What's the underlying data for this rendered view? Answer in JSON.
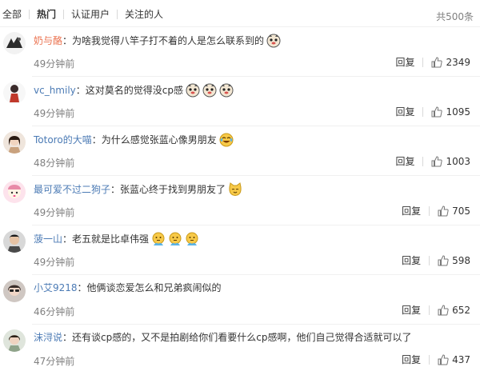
{
  "filters": {
    "tabs": [
      "全部",
      "热门",
      "认证用户",
      "关注的人"
    ],
    "active": "热门",
    "total": "共500条"
  },
  "colors": {
    "name_orange": "#eb7350",
    "name_blue": "#4c7bb5",
    "muted": "#808080"
  },
  "comments": [
    {
      "user": "奶与酪",
      "text": "：为啥我觉得八竿子打不着的人是怎么联系到的",
      "emojis": [
        "doge-icon"
      ],
      "time": "49分钟前",
      "reply": "回复",
      "likes": "2349",
      "avatar": "avatar-1"
    },
    {
      "user": "vc_hmily",
      "text": "：这对莫名的觉得没cp感",
      "emojis": [
        "doge-icon",
        "doge-icon",
        "doge-icon"
      ],
      "time": "49分钟前",
      "reply": "回复",
      "likes": "1095",
      "avatar": "avatar-2"
    },
    {
      "user": "Totoro的大喵",
      "text": "：为什么感觉张蓝心像男朋友",
      "emojis": [
        "laugh-cry-icon"
      ],
      "time": "48分钟前",
      "reply": "回复",
      "likes": "1003",
      "avatar": "avatar-3"
    },
    {
      "user": "最可爱不过二狗子",
      "text": "：张蓝心终于找到男朋友了",
      "emojis": [
        "cat-icon"
      ],
      "time": "49分钟前",
      "reply": "回复",
      "likes": "705",
      "avatar": "avatar-4"
    },
    {
      "user": "菠一山",
      "text": "：老五就是比卓伟强",
      "emojis": [
        "thinking-icon",
        "thinking-icon",
        "thinking-icon"
      ],
      "time": "49分钟前",
      "reply": "回复",
      "likes": "598",
      "avatar": "avatar-5"
    },
    {
      "user": "小艾9218",
      "text": "：他俩谈恋爱怎么和兄弟疯闹似的",
      "emojis": [],
      "time": "46分钟前",
      "reply": "回复",
      "likes": "652",
      "avatar": "avatar-6"
    },
    {
      "user": "沫浔说",
      "text": "：还有谈cp感的，又不是拍剧给你们看要什么cp感啊，他们自己觉得合适就可以了",
      "emojis": [],
      "time": "47分钟前",
      "reply": "回复",
      "likes": "437",
      "avatar": "avatar-7"
    }
  ]
}
